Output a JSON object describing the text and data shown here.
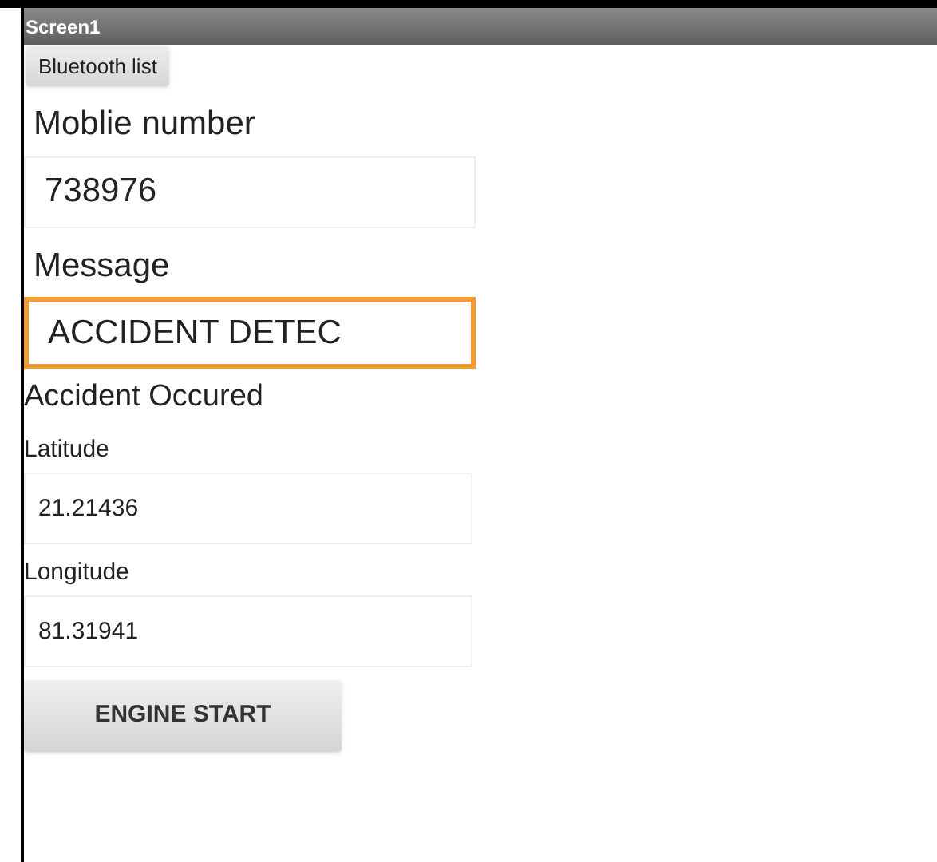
{
  "window": {
    "title": "Screen1"
  },
  "bluetooth_button": {
    "label": "Bluetooth list"
  },
  "mobile": {
    "label": "Moblie number",
    "value": "738976",
    "focused": false
  },
  "message": {
    "label": "Message",
    "value": "ACCIDENT DETEC",
    "focused": true
  },
  "status": "Accident Occured",
  "latitude": {
    "label": "Latitude",
    "value": "21.21436",
    "focused": false
  },
  "longitude": {
    "label": "Longitude",
    "value": "81.31941",
    "focused": false
  },
  "engine_button": {
    "label": "ENGINE START"
  }
}
